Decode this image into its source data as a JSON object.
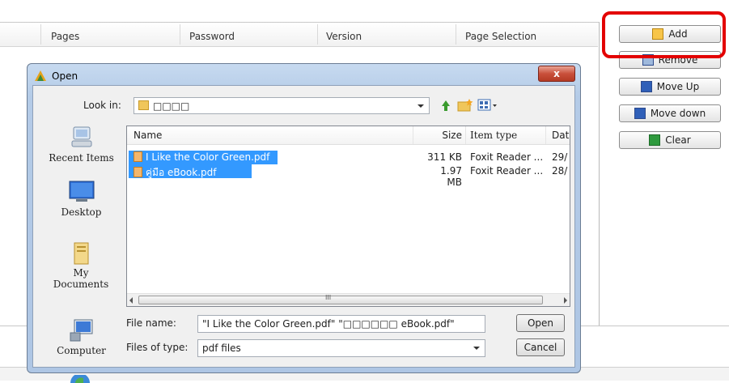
{
  "background": {
    "columns": [
      "Pages",
      "Password",
      "Version",
      "Page Selection"
    ],
    "buttons": {
      "add": "Add",
      "remove": "Remove",
      "move_up": "Move Up",
      "move_down": "Move down",
      "clear": "Clear"
    }
  },
  "dialog": {
    "title": "Open",
    "close_symbol": "x",
    "look_in_label": "Look in:",
    "look_in_value": "□□□□",
    "places": [
      "Recent Items",
      "Desktop",
      "My Documents",
      "Computer"
    ],
    "columns": {
      "name": "Name",
      "size": "Size",
      "item_type": "Item type",
      "date": "Dat"
    },
    "files": [
      {
        "name": "I Like the Color Green.pdf",
        "size": "311 KB",
        "type": "Foxit Reader ...",
        "date": "29/"
      },
      {
        "name": "คู่มือ eBook.pdf",
        "size": "1.97 MB",
        "type": "Foxit Reader ...",
        "date": "28/"
      }
    ],
    "scroll_grip": "III",
    "file_name_label": "File name:",
    "file_name_value": "\"I Like the Color Green.pdf\" \"□□□□□□ eBook.pdf\"",
    "file_type_label": "Files of type:",
    "file_type_value": "pdf files",
    "open_button": "Open",
    "cancel_button": "Cancel"
  },
  "colors": {
    "highlight": "#e30000",
    "selection": "#3399ff"
  }
}
